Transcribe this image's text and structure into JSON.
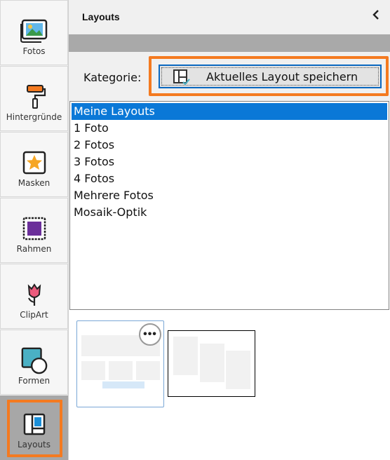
{
  "sidebar": {
    "items": [
      {
        "label": "Fotos",
        "icon": "photos-icon"
      },
      {
        "label": "Hintergründe",
        "icon": "paint-roller-icon"
      },
      {
        "label": "Masken",
        "icon": "star-mask-icon"
      },
      {
        "label": "Rahmen",
        "icon": "frame-icon"
      },
      {
        "label": "ClipArt",
        "icon": "tulip-icon"
      },
      {
        "label": "Formen",
        "icon": "shapes-icon"
      },
      {
        "label": "Layouts",
        "icon": "layout-icon",
        "active": true
      }
    ]
  },
  "panel": {
    "title": "Layouts",
    "collapse_icon": "chevron-left-icon"
  },
  "category": {
    "label": "Kategorie:",
    "save_button_label": "Aktuelles Layout speichern",
    "save_button_icon": "save-layout-icon"
  },
  "list": {
    "selected_index": 0,
    "items": [
      "Meine Layouts",
      "1 Foto",
      "2 Fotos",
      "3 Fotos",
      "4 Fotos",
      "Mehrere Fotos",
      "Mosaik-Optik"
    ]
  },
  "thumbnails": {
    "more_icon": "more-options-icon"
  },
  "colors": {
    "accent_orange": "#f47a20",
    "selection_blue": "#0a78d7",
    "button_focus_blue": "#0a68c0",
    "sidebar_active": "#a7a7a7"
  }
}
